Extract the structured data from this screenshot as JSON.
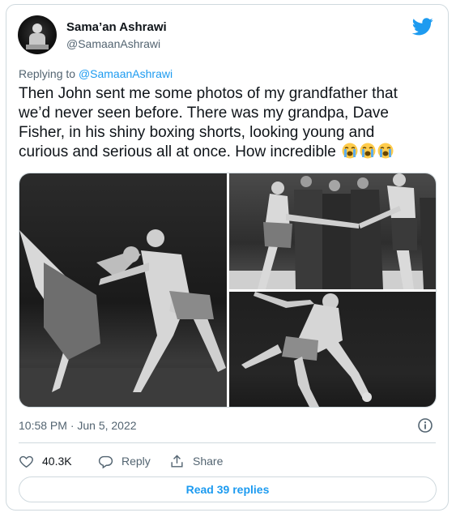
{
  "author": {
    "name": "Sama’an Ashrawi",
    "handle": "@SamaanAshrawi",
    "avatar_icon": "profile-photo"
  },
  "brand": {
    "icon": "twitter-bird-icon",
    "color": "#1d9bf0"
  },
  "reply_context": {
    "prefix": "Replying to ",
    "mention": "@SamaanAshrawi"
  },
  "tweet": {
    "text": "Then John sent me some photos of my grandfather that we’d never seen before. There was my grandpa, Dave Fisher, in his shiny boxing shorts, looking young and curious and serious all at once. How incredible",
    "emojis": [
      "loudly-crying-face",
      "loudly-crying-face",
      "loudly-crying-face"
    ],
    "timestamp": "10:58 PM · Jun 5, 2022"
  },
  "media": [
    {
      "name": "photo-dancers-lunge"
    },
    {
      "name": "photo-group-stage"
    },
    {
      "name": "photo-dancer-leaning"
    }
  ],
  "actions": {
    "like_count": "40.3K",
    "reply_label": "Reply",
    "share_label": "Share"
  },
  "read_replies": "Read 39 replies",
  "colors": {
    "accent": "#1d9bf0",
    "secondary_text": "#536471",
    "border": "#cfd9de"
  }
}
